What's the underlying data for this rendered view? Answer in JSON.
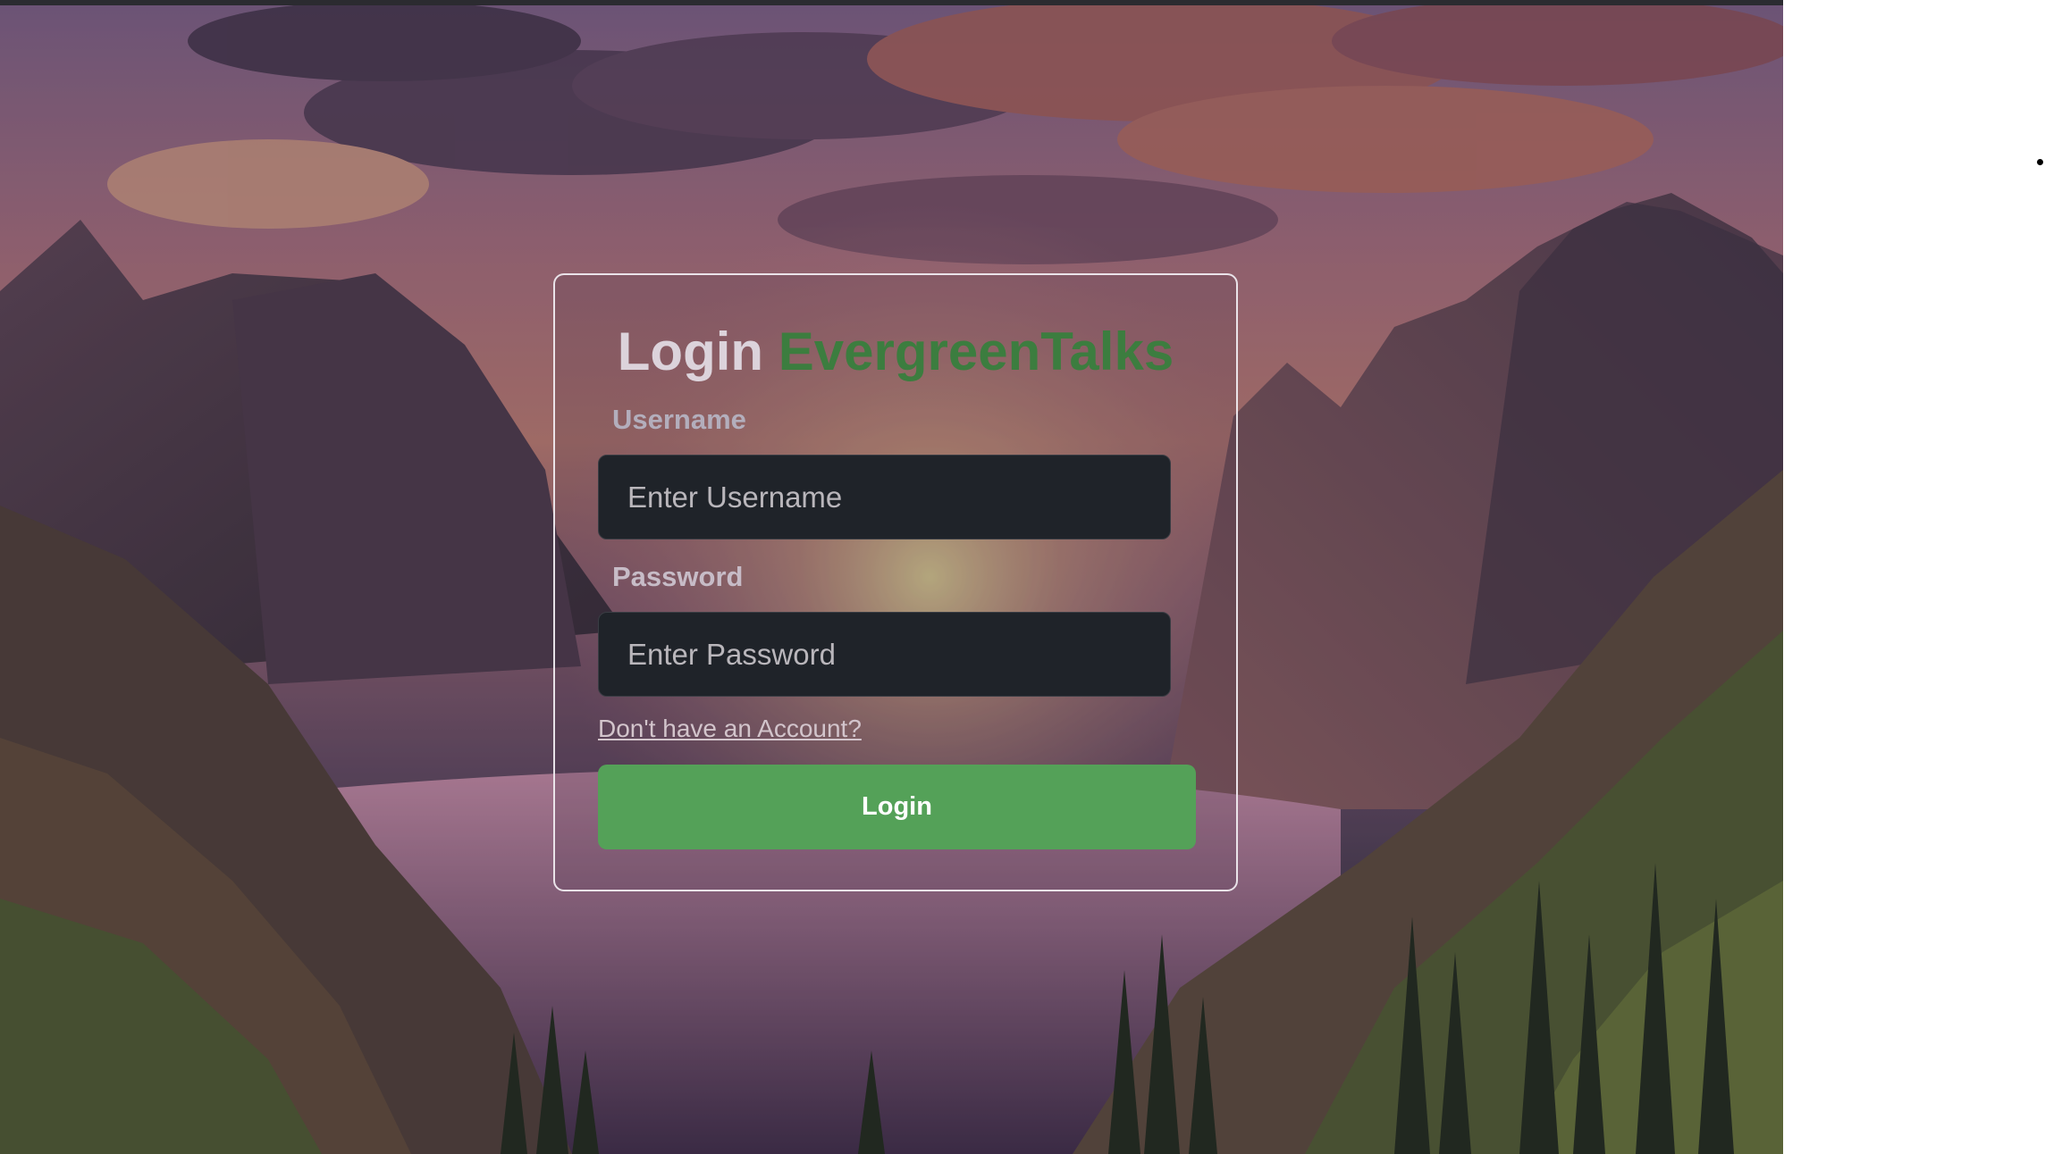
{
  "login_card": {
    "title_prefix": "Login",
    "title_brand": "EvergreenTalks",
    "username": {
      "label": "Username",
      "placeholder": "Enter Username",
      "value": ""
    },
    "password": {
      "label": "Password",
      "placeholder": "Enter Password",
      "value": ""
    },
    "signup_link": "Don't have an Account?",
    "login_button": "Login"
  },
  "colors": {
    "brand_green": "#3c7d3f",
    "button_green": "#54a158",
    "input_bg": "#1f2329"
  }
}
